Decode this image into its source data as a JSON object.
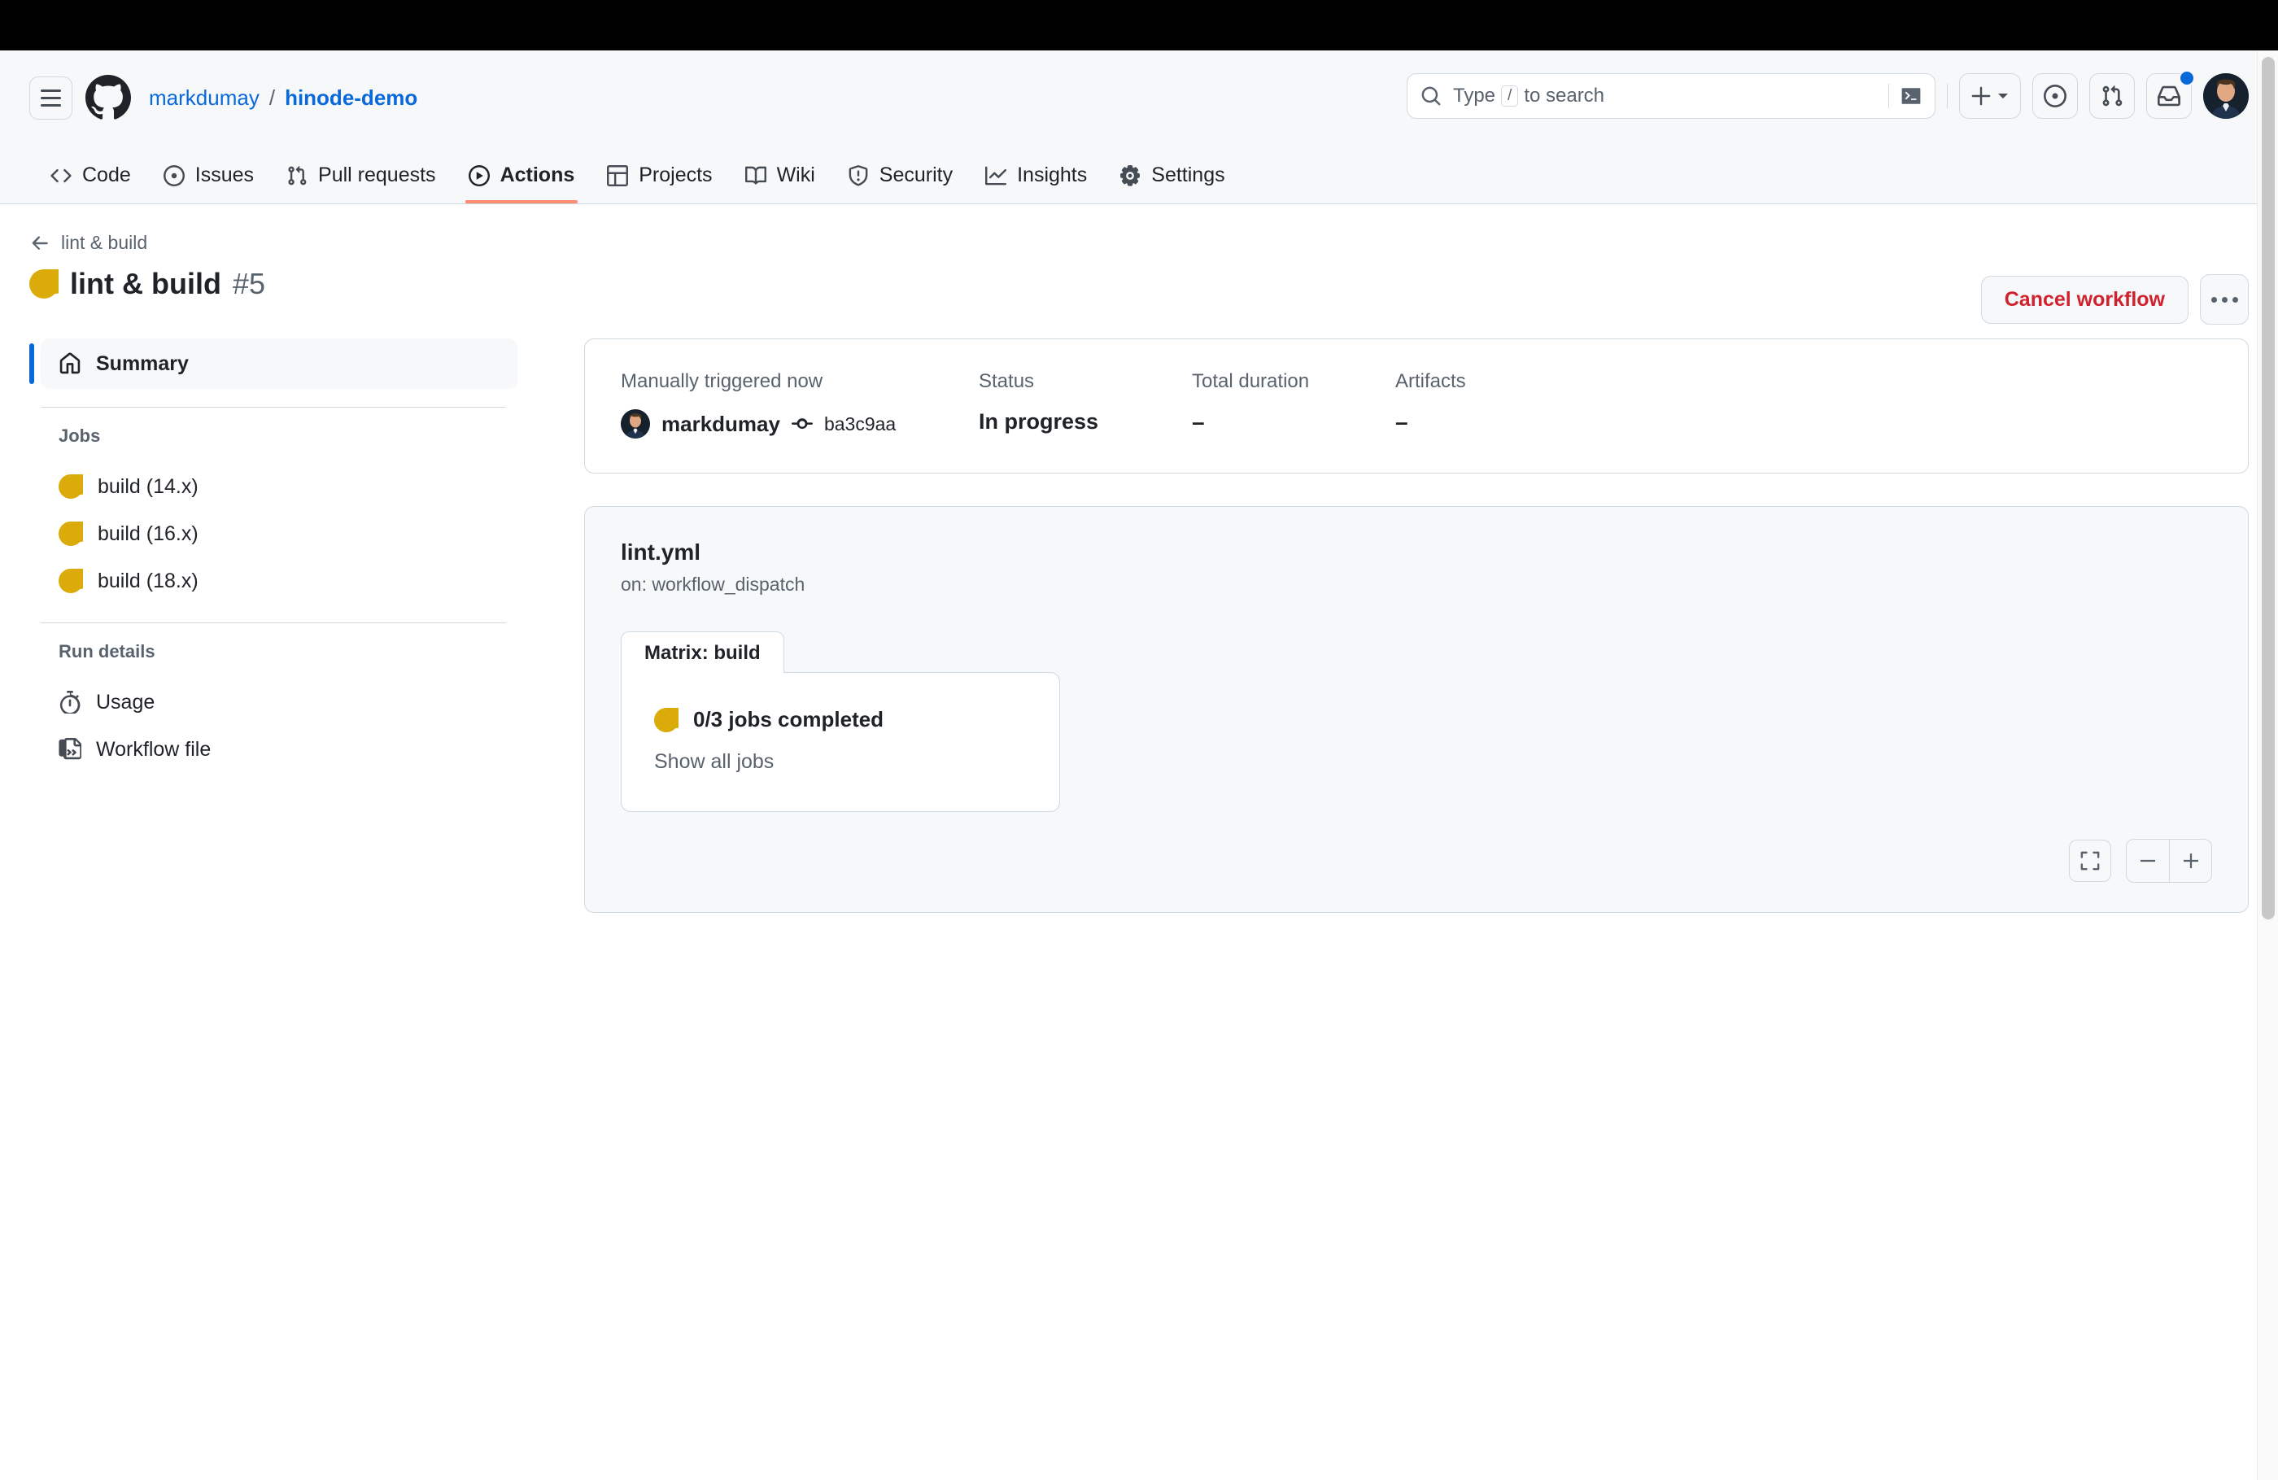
{
  "browser": {
    "chrome_color": "#000000"
  },
  "header": {
    "hamburger_label": "Open navigation menu",
    "logo_name": "github-logo",
    "owner": "markdumay",
    "separator": "/",
    "repo": "hinode-demo",
    "search": {
      "placeholder_prefix": "Type",
      "slash_key": "/",
      "placeholder_suffix": "to search"
    },
    "actions": {
      "create_new": "+",
      "issues": "Issues",
      "pull_requests": "Pull requests",
      "notifications": "Notifications",
      "avatar": "markdumay"
    }
  },
  "repo_nav": [
    {
      "label": "Code",
      "icon": "code-icon",
      "active": false
    },
    {
      "label": "Issues",
      "icon": "issue-opened-icon",
      "active": false
    },
    {
      "label": "Pull requests",
      "icon": "git-pull-request-icon",
      "active": false
    },
    {
      "label": "Actions",
      "icon": "play-icon",
      "active": true
    },
    {
      "label": "Projects",
      "icon": "table-icon",
      "active": false
    },
    {
      "label": "Wiki",
      "icon": "book-icon",
      "active": false
    },
    {
      "label": "Security",
      "icon": "shield-icon",
      "active": false
    },
    {
      "label": "Insights",
      "icon": "graph-icon",
      "active": false
    },
    {
      "label": "Settings",
      "icon": "gear-icon",
      "active": false
    }
  ],
  "run": {
    "back_label": "lint & build",
    "title": "lint & build",
    "number": "#5",
    "status_icon": "in-progress-icon",
    "cancel_label": "Cancel workflow",
    "kebab_label": "More options"
  },
  "sidebar": {
    "summary": {
      "label": "Summary",
      "icon": "home-icon"
    },
    "jobs_heading": "Jobs",
    "jobs": [
      {
        "label": "build (14.x)",
        "status": "in-progress"
      },
      {
        "label": "build (16.x)",
        "status": "in-progress"
      },
      {
        "label": "build (18.x)",
        "status": "in-progress"
      }
    ],
    "run_details_heading": "Run details",
    "run_details": [
      {
        "label": "Usage",
        "icon": "stopwatch-icon"
      },
      {
        "label": "Workflow file",
        "icon": "file-code-icon"
      }
    ]
  },
  "summary_card": {
    "trigger_label": "Manually triggered now",
    "actor": "markdumay",
    "commit_sha": "ba3c9aa",
    "status_label": "Status",
    "status_value": "In progress",
    "duration_label": "Total duration",
    "duration_value": "–",
    "artifacts_label": "Artifacts",
    "artifacts_value": "–"
  },
  "graph": {
    "workflow_file": "lint.yml",
    "trigger": "on: workflow_dispatch",
    "matrix_tab": "Matrix: build",
    "jobs_completed": "0/3 jobs completed",
    "show_all": "Show all jobs",
    "controls": {
      "fit": "Fit to screen",
      "zoom_out": "–",
      "zoom_in": "+"
    }
  },
  "colors": {
    "in_progress": "#bf8700",
    "accent": "#0969da",
    "danger": "#cf222e",
    "active_tab_underline": "#fd8c73",
    "canvas_subtle": "#f6f8fa",
    "border": "#d1d9e0"
  }
}
